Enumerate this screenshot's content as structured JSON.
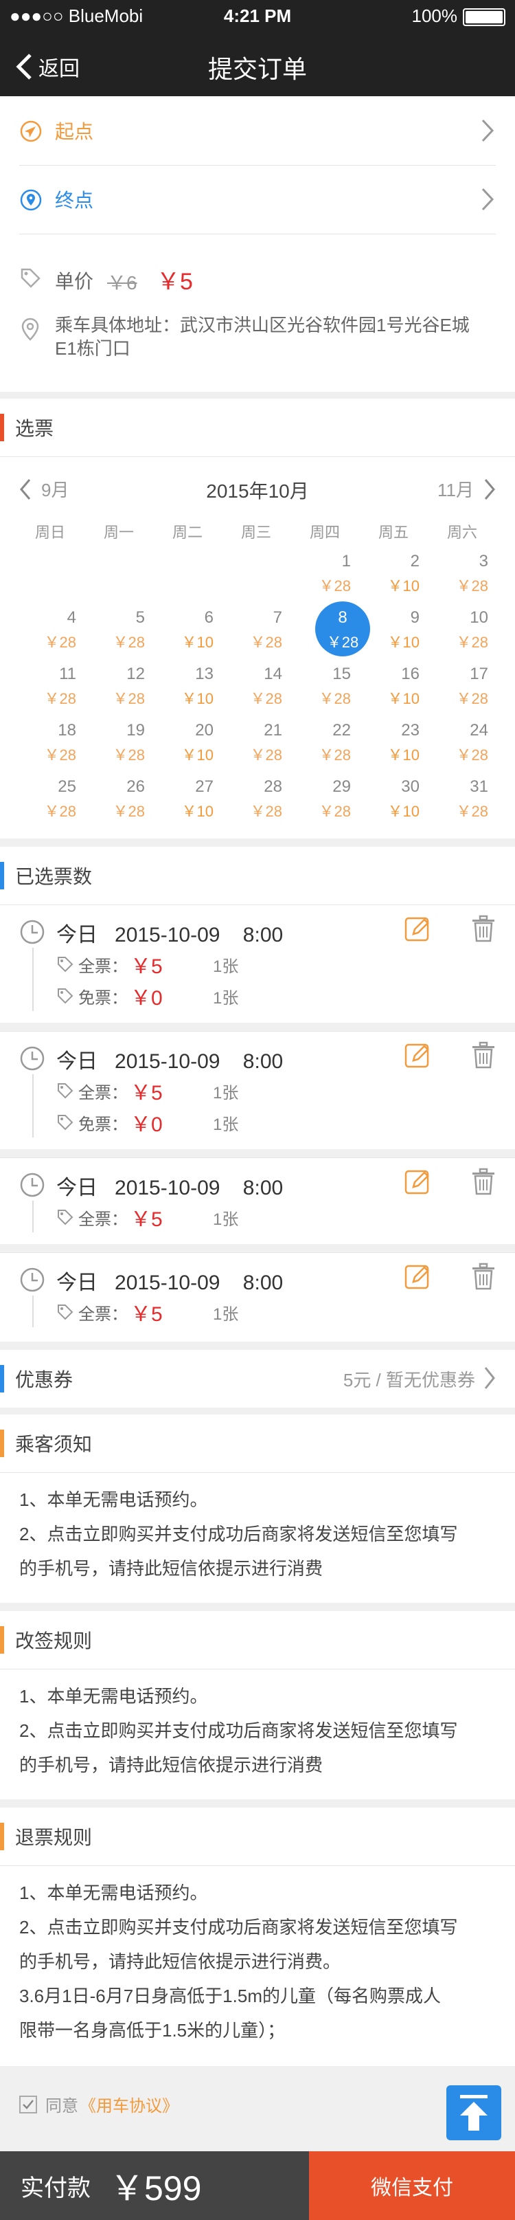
{
  "status": {
    "carrier": "●●●○○ BlueMobi",
    "time": "4:21 PM",
    "battery": "100%"
  },
  "nav": {
    "back": "返回",
    "title": "提交订单"
  },
  "route": {
    "start": "起点",
    "end": "终点"
  },
  "price": {
    "label": "单价",
    "old": "￥6",
    "new": "￥5"
  },
  "address": "乘车具体地址：武汉市洪山区光谷软件园1号光谷E城 E1栋门口",
  "calendar": {
    "section": "选票",
    "prev": "9月",
    "title": "2015年10月",
    "next": "11月",
    "weekdays": [
      "周日",
      "周一",
      "周二",
      "周三",
      "周四",
      "周五",
      "周六"
    ],
    "selected_day": "8",
    "days": [
      {
        "d": "1",
        "p": "￥28"
      },
      {
        "d": "2",
        "p": "￥10"
      },
      {
        "d": "3",
        "p": "￥28"
      },
      {
        "d": "4",
        "p": "￥28"
      },
      {
        "d": "5",
        "p": "￥28"
      },
      {
        "d": "6",
        "p": "￥10"
      },
      {
        "d": "7",
        "p": "￥28"
      },
      {
        "d": "8",
        "p": "￥28"
      },
      {
        "d": "9",
        "p": "￥10"
      },
      {
        "d": "10",
        "p": "￥28"
      },
      {
        "d": "11",
        "p": "￥28"
      },
      {
        "d": "12",
        "p": "￥28"
      },
      {
        "d": "13",
        "p": "￥10"
      },
      {
        "d": "14",
        "p": "￥28"
      },
      {
        "d": "15",
        "p": "￥28"
      },
      {
        "d": "16",
        "p": "￥10"
      },
      {
        "d": "17",
        "p": "￥28"
      },
      {
        "d": "18",
        "p": "￥28"
      },
      {
        "d": "19",
        "p": "￥28"
      },
      {
        "d": "20",
        "p": "￥10"
      },
      {
        "d": "21",
        "p": "￥28"
      },
      {
        "d": "22",
        "p": "￥28"
      },
      {
        "d": "23",
        "p": "￥10"
      },
      {
        "d": "24",
        "p": "￥28"
      },
      {
        "d": "25",
        "p": "￥28"
      },
      {
        "d": "26",
        "p": "￥28"
      },
      {
        "d": "27",
        "p": "￥10"
      },
      {
        "d": "28",
        "p": "￥28"
      },
      {
        "d": "29",
        "p": "￥28"
      },
      {
        "d": "30",
        "p": "￥10"
      },
      {
        "d": "31",
        "p": "￥28"
      }
    ]
  },
  "selected": {
    "section": "已选票数",
    "tickets": [
      {
        "title": "今日   2015-10-09    8:00",
        "rows": [
          {
            "label": "全票：",
            "amount": "￥5",
            "count": "1张"
          },
          {
            "label": "免票：",
            "amount": "￥0",
            "count": "1张"
          }
        ]
      },
      {
        "title": "今日   2015-10-09    8:00",
        "rows": [
          {
            "label": "全票：",
            "amount": "￥5",
            "count": "1张"
          },
          {
            "label": "免票：",
            "amount": "￥0",
            "count": "1张"
          }
        ]
      },
      {
        "title": "今日   2015-10-09    8:00",
        "rows": [
          {
            "label": "全票：",
            "amount": "￥5",
            "count": "1张"
          }
        ]
      },
      {
        "title": "今日   2015-10-09    8:00",
        "rows": [
          {
            "label": "全票：",
            "amount": "￥5",
            "count": "1张"
          }
        ]
      }
    ]
  },
  "coupon": {
    "label": "优惠券",
    "value": "5元 / 暂无优惠券"
  },
  "notice": {
    "title": "乘客须知",
    "lines": [
      "1、本单无需电话预约。",
      "2、点击立即购买并支付成功后商家将发送短信至您填写",
      "的手机号，请持此短信依提示进行消费"
    ]
  },
  "change_rules": {
    "title": "改签规则",
    "lines": [
      "1、本单无需电话预约。",
      "2、点击立即购买并支付成功后商家将发送短信至您填写",
      "的手机号，请持此短信依提示进行消费"
    ]
  },
  "refund_rules": {
    "title": "退票规则",
    "lines": [
      "1、本单无需电话预约。",
      "2、点击立即购买并支付成功后商家将发送短信至您填写",
      "的手机号，请持此短信依提示进行消费。",
      "3.6月1日-6月7日身高低于1.5m的儿童（每名购票成人",
      "限带一名身高低于1.5米的儿童）；"
    ]
  },
  "agree": {
    "prefix": "同意",
    "link": "《用车协议》"
  },
  "bottom": {
    "label": "实付款",
    "amount": "￥599",
    "pay": "微信支付"
  },
  "colors": {
    "accent_orange": "#f39a3c",
    "accent_blue": "#2b8ce8",
    "price_red": "#e52b2b",
    "pay_orange": "#e8502a"
  }
}
